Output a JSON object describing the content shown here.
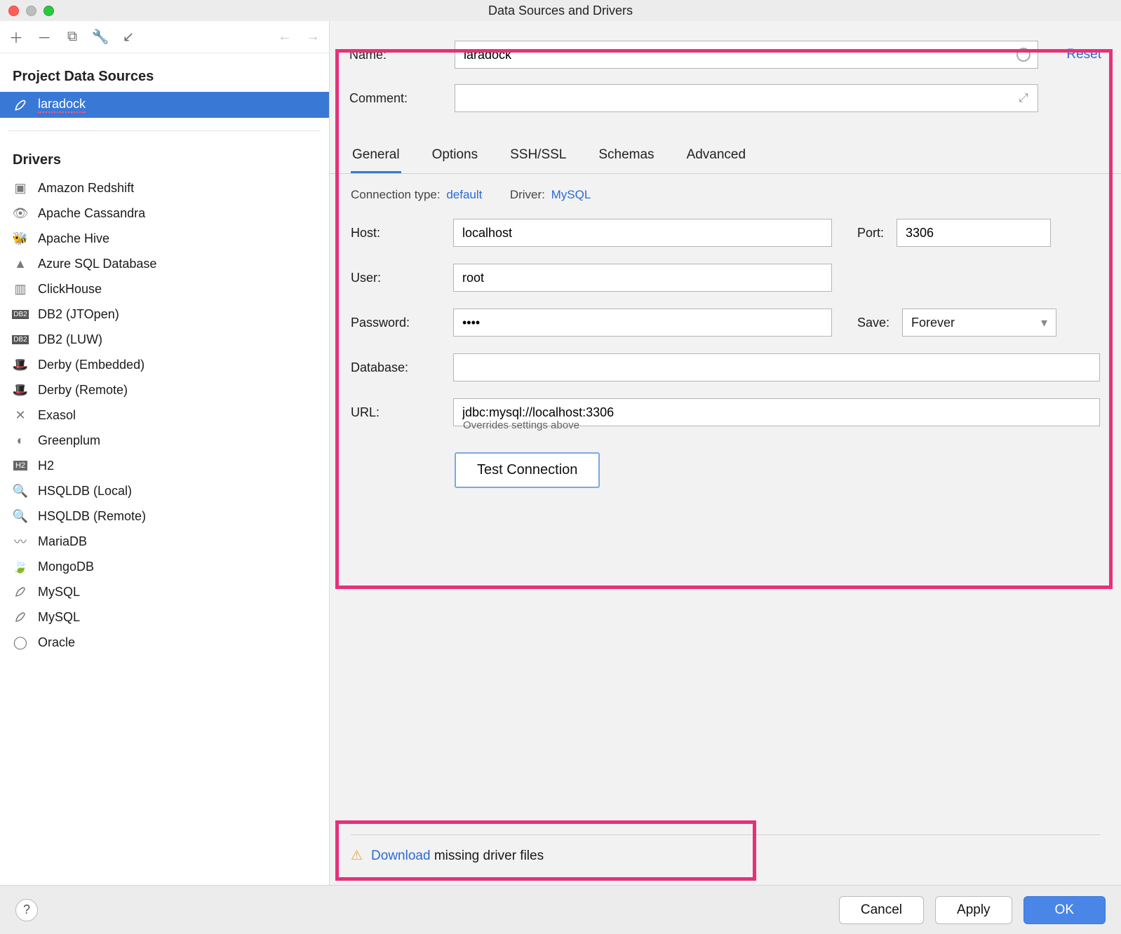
{
  "titlebar": {
    "title": "Data Sources and Drivers"
  },
  "sidebar": {
    "section_sources": "Project Data Sources",
    "sources": [
      {
        "label": "laradock",
        "icon": "feather"
      }
    ],
    "section_drivers": "Drivers",
    "drivers": [
      {
        "label": "Amazon Redshift",
        "icon": "cube"
      },
      {
        "label": "Apache Cassandra",
        "icon": "eye"
      },
      {
        "label": "Apache Hive",
        "icon": "bee"
      },
      {
        "label": "Azure SQL Database",
        "icon": "azure"
      },
      {
        "label": "ClickHouse",
        "icon": "bars"
      },
      {
        "label": "DB2 (JTOpen)",
        "icon": "db2"
      },
      {
        "label": "DB2 (LUW)",
        "icon": "db2"
      },
      {
        "label": "Derby (Embedded)",
        "icon": "hat"
      },
      {
        "label": "Derby (Remote)",
        "icon": "hat"
      },
      {
        "label": "Exasol",
        "icon": "x"
      },
      {
        "label": "Greenplum",
        "icon": "circle"
      },
      {
        "label": "H2",
        "icon": "h2"
      },
      {
        "label": "HSQLDB (Local)",
        "icon": "search"
      },
      {
        "label": "HSQLDB (Remote)",
        "icon": "search"
      },
      {
        "label": "MariaDB",
        "icon": "seal"
      },
      {
        "label": "MongoDB",
        "icon": "leaf"
      },
      {
        "label": "MySQL",
        "icon": "feather-grey"
      },
      {
        "label": "MySQL",
        "icon": "feather-grey"
      },
      {
        "label": "Oracle",
        "icon": "oracle"
      }
    ]
  },
  "form": {
    "name_label": "Name:",
    "name_value": "laradock",
    "comment_label": "Comment:",
    "comment_value": "",
    "reset": "Reset",
    "tabs": [
      "General",
      "Options",
      "SSH/SSL",
      "Schemas",
      "Advanced"
    ],
    "conn_type_label": "Connection type:",
    "conn_type_value": "default",
    "driver_label": "Driver:",
    "driver_value": "MySQL",
    "host_label": "Host:",
    "host_value": "localhost",
    "port_label": "Port:",
    "port_value": "3306",
    "user_label": "User:",
    "user_value": "root",
    "pass_label": "Password:",
    "pass_value": "••••",
    "save_label": "Save:",
    "save_value": "Forever",
    "db_label": "Database:",
    "db_value": "",
    "url_label": "URL:",
    "url_value": "jdbc:mysql://localhost:3306",
    "url_hint": "Overrides settings above",
    "test_btn": "Test Connection",
    "download_link": "Download",
    "download_rest": "missing driver files"
  },
  "footer": {
    "cancel": "Cancel",
    "apply": "Apply",
    "ok": "OK"
  }
}
